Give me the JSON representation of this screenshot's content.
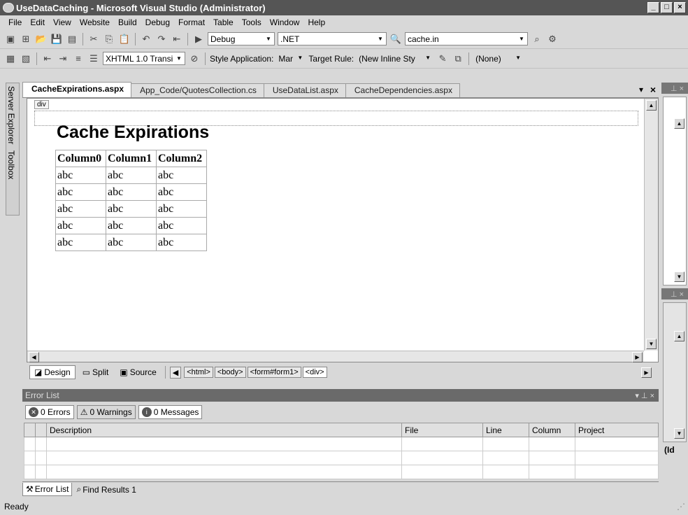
{
  "window": {
    "title": "UseDataCaching - Microsoft Visual Studio (Administrator)",
    "min": "_",
    "max": "□",
    "close": "×"
  },
  "menu": [
    "File",
    "Edit",
    "View",
    "Website",
    "Build",
    "Debug",
    "Format",
    "Table",
    "Tools",
    "Window",
    "Help"
  ],
  "toolbar1": {
    "config": "Debug",
    "platform": ".NET",
    "find": "cache.in"
  },
  "toolbar2": {
    "doctype": "XHTML 1.0 Transi",
    "style_app_label": "Style Application:",
    "style_app_value": "Mar",
    "target_rule_label": "Target Rule:",
    "target_rule_value": "(New Inline Sty",
    "class_value": "(None)"
  },
  "leftdock": {
    "server_explorer": "Server Explorer",
    "toolbox": "Toolbox"
  },
  "doctabs": [
    "CacheExpirations.aspx",
    "App_Code/QuotesCollection.cs",
    "UseDataList.aspx",
    "CacheDependencies.aspx"
  ],
  "design": {
    "div_tag": "div",
    "heading": "Cache Expirations",
    "grid": {
      "headers": [
        "Column0",
        "Column1",
        "Column2"
      ],
      "rows": [
        [
          "abc",
          "abc",
          "abc"
        ],
        [
          "abc",
          "abc",
          "abc"
        ],
        [
          "abc",
          "abc",
          "abc"
        ],
        [
          "abc",
          "abc",
          "abc"
        ],
        [
          "abc",
          "abc",
          "abc"
        ]
      ]
    }
  },
  "viewbar": {
    "design": "Design",
    "split": "Split",
    "source": "Source",
    "crumbs": [
      "<html>",
      "<body>",
      "<form#form1>",
      "<div>"
    ]
  },
  "errorlist": {
    "title": "Error List",
    "errors": "0 Errors",
    "warnings": "0 Warnings",
    "messages": "0 Messages",
    "columns": [
      "Description",
      "File",
      "Line",
      "Column",
      "Project"
    ],
    "tabs": [
      "Error List",
      "Find Results 1"
    ]
  },
  "rightpanel": {
    "label": "(Id"
  },
  "status": "Ready"
}
